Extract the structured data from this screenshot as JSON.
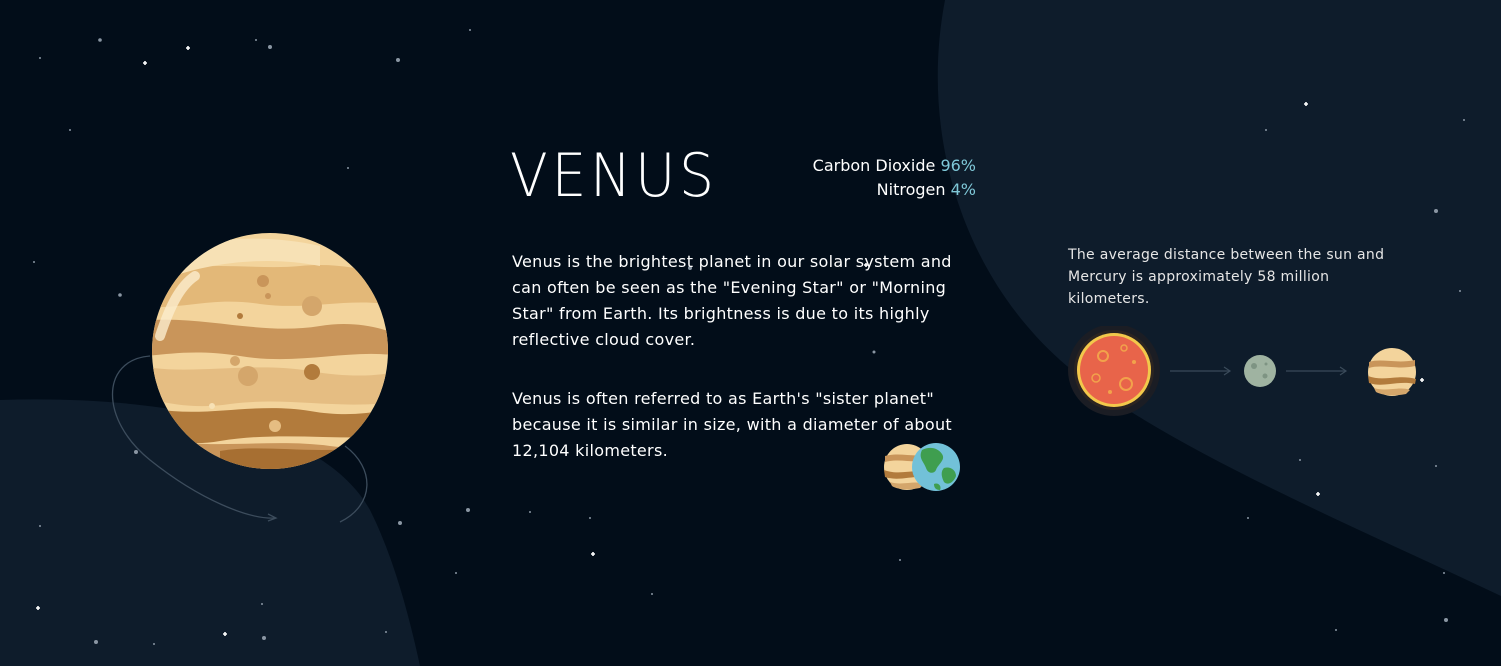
{
  "planet": {
    "name": "VENUS",
    "composition": [
      {
        "gas": "Carbon Dioxide",
        "percent": "96%"
      },
      {
        "gas": "Nitrogen",
        "percent": "4%"
      }
    ],
    "paragraphs": [
      "Venus is the brightest planet in our solar system and can often be seen as the \"Evening Star\" or \"Morning Star\" from Earth. Its brightness is due to its highly reflective cloud cover.",
      "Venus is often referred to as Earth's \"sister planet\" because it is similar in size, with a diameter of about 12,104 kilometers."
    ]
  },
  "distance": {
    "text": "The average distance between the sun and Mercury is approximately 58 million kilometers."
  },
  "icons": {
    "venus": "venus-planet-icon",
    "earth": "earth-planet-icon",
    "sun": "sun-icon",
    "mercury": "mercury-planet-icon"
  },
  "colors": {
    "background": "#020d19",
    "panel": "#0e1c2b",
    "accent": "#7fc8d8",
    "venus_light": "#f6dcaa",
    "venus_dark": "#b27b3c"
  }
}
